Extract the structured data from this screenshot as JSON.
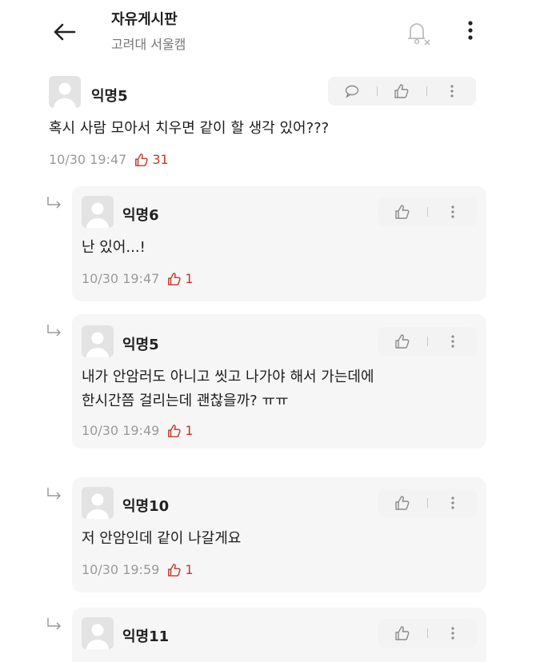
{
  "header": {
    "title": "자유게시판",
    "subtitle": "고려대 서울캠"
  },
  "comments": [
    {
      "author": "익명5",
      "text_lines": [
        "혹시 사람 모아서 치우면 같이 할 생각 있어???"
      ],
      "time": "10/30 19:47",
      "likes": "31"
    }
  ],
  "replies": [
    {
      "author": "익명6",
      "text_lines": [
        "난 있어...!"
      ],
      "time": "10/30 19:47",
      "likes": "1"
    },
    {
      "author": "익명5",
      "text_lines": [
        "내가 안암러도 아니고 씻고 나가야 해서 가는데에",
        "한시간쯤 걸리는데 괜찮을까? ㅠㅠ"
      ],
      "time": "10/30 19:49",
      "likes": "1"
    },
    {
      "author": "익명10",
      "text_lines": [
        "저 안암인데 같이 나갈게요"
      ],
      "time": "10/30 19:59",
      "likes": "1"
    },
    {
      "author": "익명11",
      "text_lines": [],
      "time": "",
      "likes": ""
    }
  ],
  "colors": {
    "like": "#c0392b",
    "card": "#f6f6f6",
    "meta": "#9a9a9a"
  }
}
